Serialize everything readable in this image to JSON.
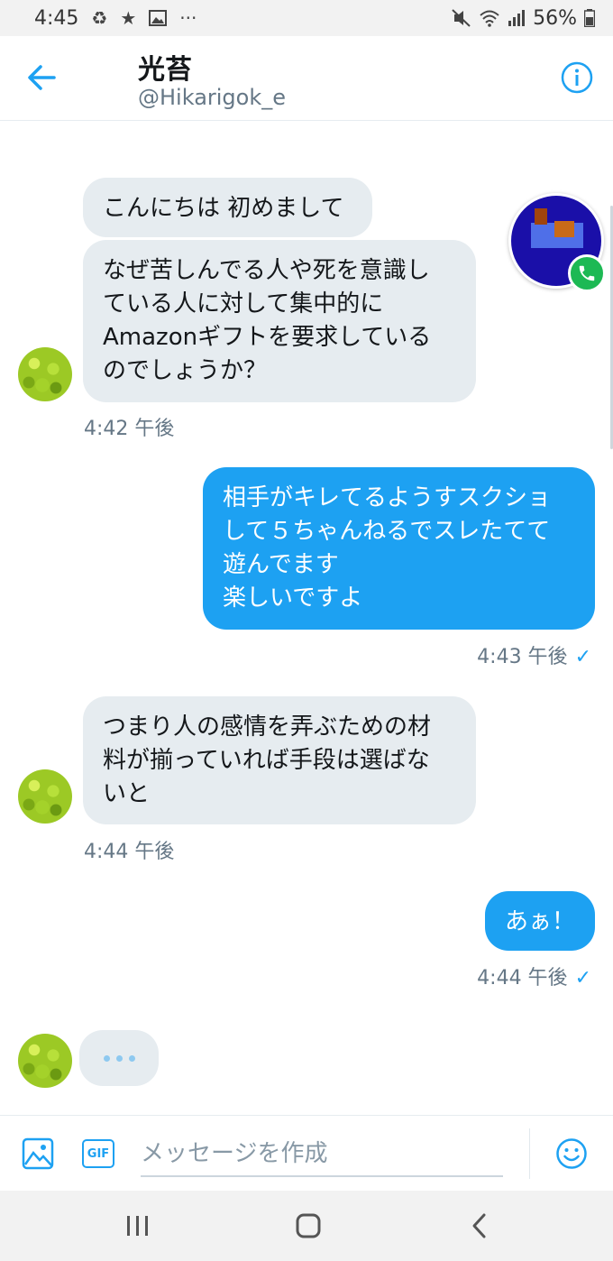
{
  "status_bar": {
    "time": "4:45",
    "notif_icons": [
      "recycle-icon",
      "star-icon",
      "image-icon",
      "more-icon"
    ],
    "battery": "56%"
  },
  "header": {
    "title": "光苔",
    "handle": "@Hikarigok_e"
  },
  "messages": [
    {
      "direction": "in",
      "lines": [
        "こんにちは 初めまして"
      ]
    },
    {
      "direction": "in",
      "lines": [
        "なぜ苦しんでる人や死を意識し",
        "ている人に対して集中的に",
        "Amazonギフトを要求している",
        "のでしょうか？"
      ]
    },
    {
      "time": "4:42 午後"
    },
    {
      "direction": "out",
      "lines": [
        "相手がキレてるようすスクショ",
        "して５ちゃんねるでスレたてて",
        "遊んでます",
        "楽しいですよ"
      ]
    },
    {
      "time": "4:43 午後"
    },
    {
      "direction": "in",
      "lines": [
        "つまり人の感情を弄ぶための材",
        "料が揃っていれば手段は選ばな",
        "いと"
      ]
    },
    {
      "time": "4:44 午後"
    },
    {
      "direction": "out",
      "lines": [
        "あぁ！"
      ]
    },
    {
      "time": "4:44 午後"
    }
  ],
  "composer": {
    "placeholder": "メッセージを作成",
    "gif_label": "GIF"
  },
  "colors": {
    "accent": "#1da1f2",
    "incoming_bubble": "#e6ecf0",
    "call_badge": "#1db954"
  }
}
